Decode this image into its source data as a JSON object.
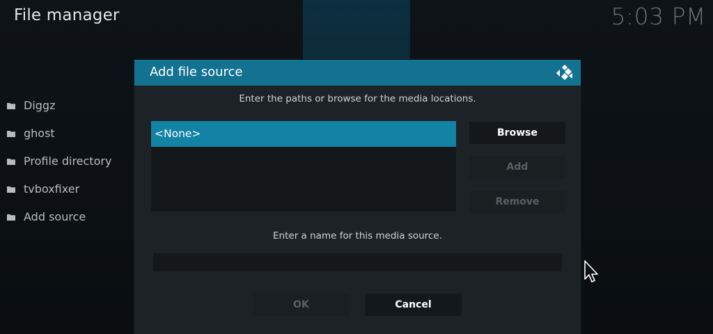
{
  "app": {
    "title": "File manager",
    "clock": "5:03 PM"
  },
  "sources": [
    {
      "label": "Diggz",
      "icon": "folder-icon"
    },
    {
      "label": "ghost",
      "icon": "folder-icon"
    },
    {
      "label": "Profile directory",
      "icon": "folder-icon"
    },
    {
      "label": "tvboxfixer",
      "icon": "folder-icon"
    },
    {
      "label": "Add source",
      "icon": "folder-icon"
    }
  ],
  "dialog": {
    "title": "Add file source",
    "logo_icon": "kodi-logo-icon",
    "paths_instruction": "Enter the paths or browse for the media locations.",
    "paths": [
      {
        "label": "<None>",
        "selected": true
      }
    ],
    "buttons": {
      "browse": "Browse",
      "add": "Add",
      "remove": "Remove",
      "ok": "OK",
      "cancel": "Cancel"
    },
    "name_instruction": "Enter a name for this media source.",
    "name_value": ""
  },
  "colors": {
    "accent": "#12728f",
    "selection": "#1283a5",
    "panel": "#1d2226",
    "disabled_text": "#5a5f63"
  }
}
